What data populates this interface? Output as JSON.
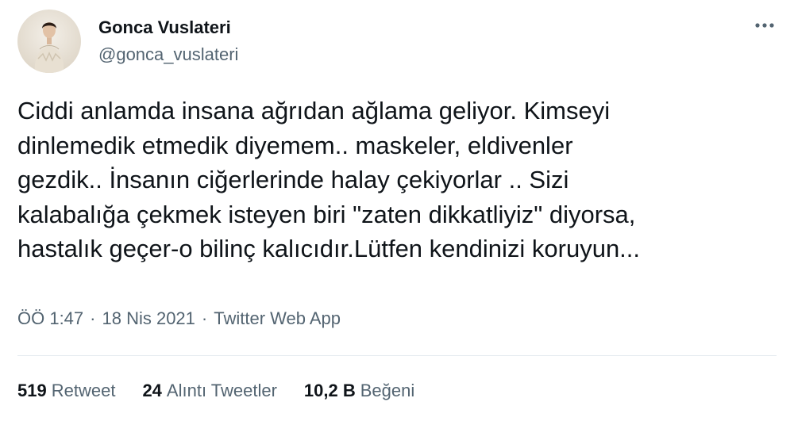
{
  "user": {
    "display_name": "Gonca Vuslateri",
    "handle": "@gonca_vuslateri",
    "avatar_icon": "profile-photo"
  },
  "more_icon": "ellipsis-icon",
  "tweet": {
    "text": "Ciddi anlamda insana ağrıdan ağlama geliyor. Kimseyi\ndinlemedik etmedik diyemem.. maskeler, eldivenler\ngezdik.. İnsanın ciğerlerinde halay çekiyorlar .. Sizi\nkalabalığa çekmek isteyen biri \"zaten dikkatliyiz\" diyorsa,\nhastalık geçer-o bilinç kalıcıdır.Lütfen kendinizi koruyun..."
  },
  "meta": {
    "time": "ÖÖ 1:47",
    "separator": "·",
    "date": "18 Nis 2021",
    "source": "Twitter Web App"
  },
  "stats": {
    "retweets": {
      "count": "519",
      "label": "Retweet"
    },
    "quotes": {
      "count": "24",
      "label": "Alıntı Tweetler"
    },
    "likes": {
      "count": "10,2 B",
      "label": "Beğeni"
    }
  },
  "colors": {
    "text_primary": "#0f1419",
    "text_secondary": "#536471",
    "divider": "#e6ecf0"
  }
}
